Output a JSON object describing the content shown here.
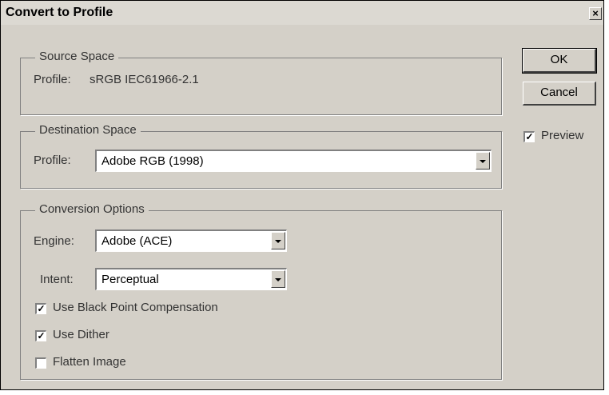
{
  "dialog": {
    "title": "Convert to Profile",
    "close_glyph": "×"
  },
  "source_space": {
    "legend": "Source Space",
    "profile_label": "Profile:",
    "profile_value": "sRGB IEC61966-2.1"
  },
  "destination_space": {
    "legend": "Destination Space",
    "profile_label": "Profile:",
    "profile_value": "Adobe RGB (1998)"
  },
  "conversion_options": {
    "legend": "Conversion Options",
    "engine_label": "Engine:",
    "engine_value": "Adobe (ACE)",
    "intent_label": "Intent:",
    "intent_value": "Perceptual",
    "checkboxes": [
      {
        "label": "Use Black Point Compensation",
        "checked": true
      },
      {
        "label": "Use Dither",
        "checked": true
      },
      {
        "label": "Flatten Image",
        "checked": false
      }
    ]
  },
  "buttons": {
    "ok_label": "OK",
    "cancel_label": "Cancel"
  },
  "preview": {
    "label": "Preview",
    "checked": true
  },
  "icons": [
    "close-icon",
    "dropdown-arrow-icon",
    "checkbox-check-icon"
  ]
}
